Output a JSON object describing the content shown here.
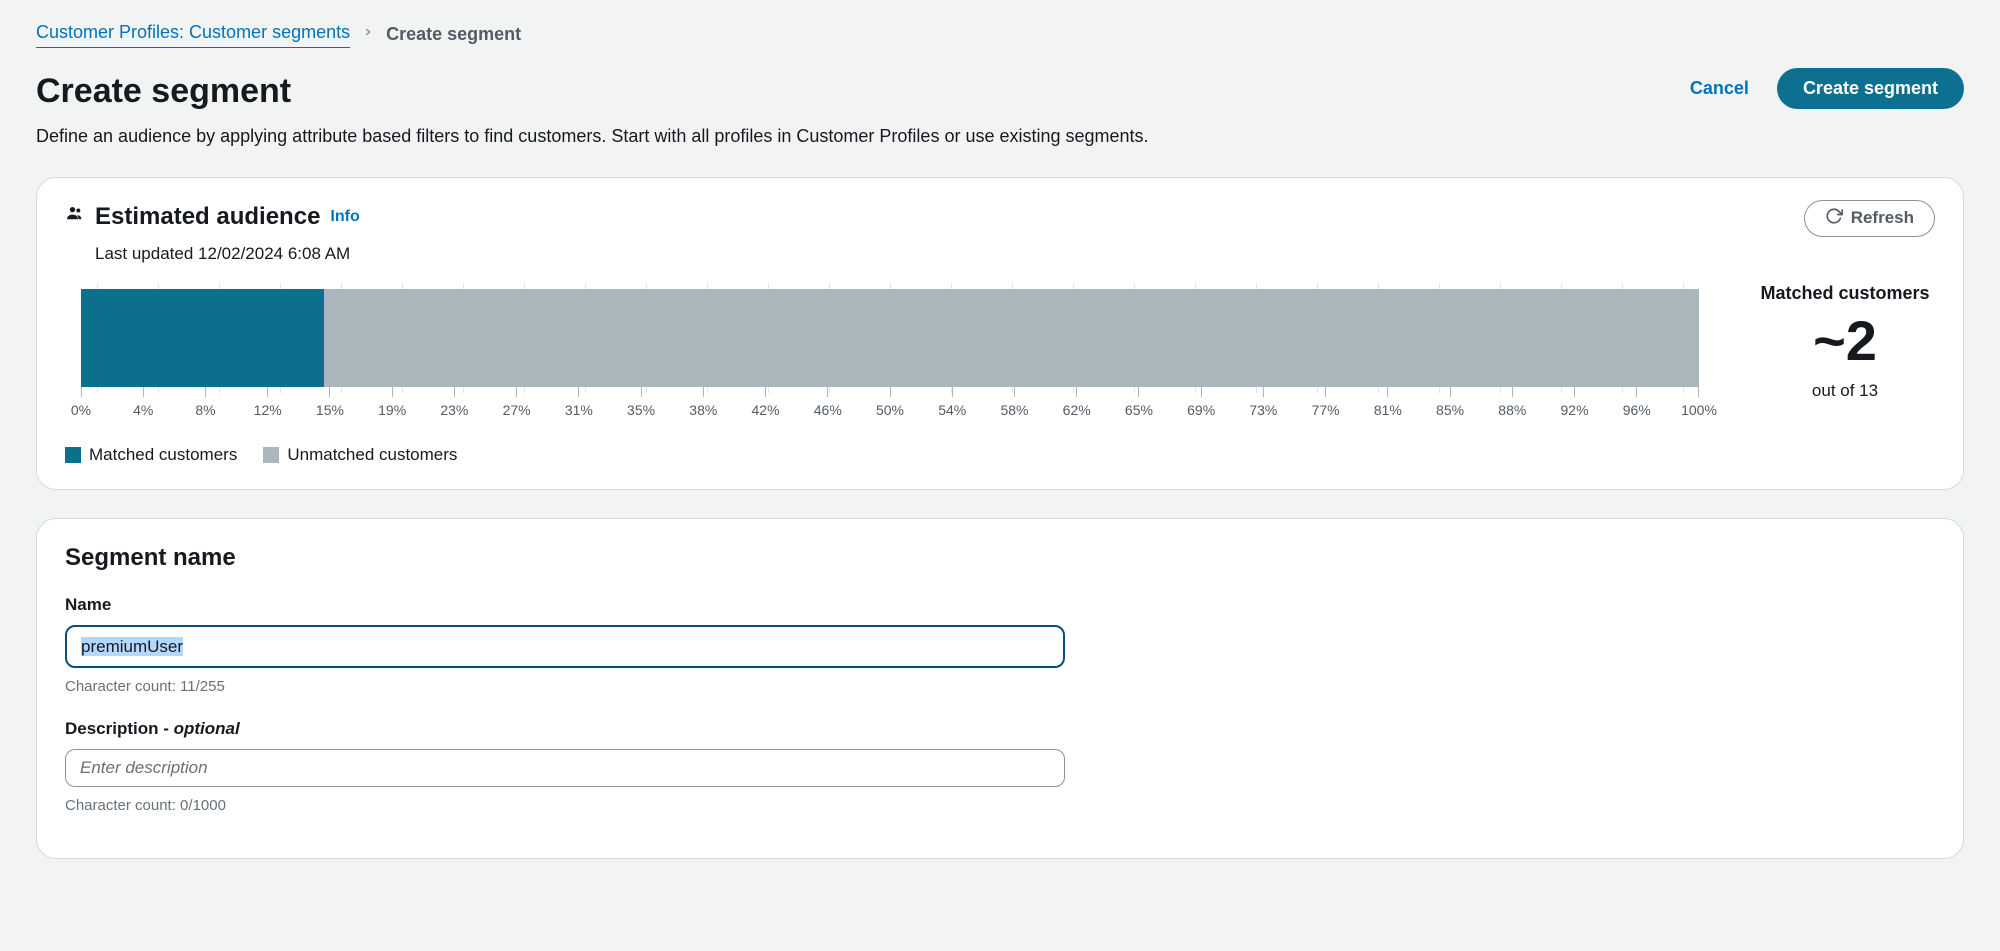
{
  "breadcrumb": {
    "parent": "Customer Profiles: Customer segments",
    "current": "Create segment"
  },
  "header": {
    "title": "Create segment",
    "subtitle": "Define an audience by applying attribute based filters to find customers. Start with all profiles in Customer Profiles or use existing segments.",
    "cancel_label": "Cancel",
    "create_label": "Create segment"
  },
  "audience_panel": {
    "title": "Estimated audience",
    "info_label": "Info",
    "refresh_label": "Refresh",
    "last_updated": "Last updated 12/02/2024 6:08 AM",
    "matched_label": "Matched customers",
    "matched_display": "~2",
    "out_of": "out of 13",
    "legend_matched": "Matched customers",
    "legend_unmatched": "Unmatched customers"
  },
  "chart_data": {
    "type": "bar",
    "orientation": "single-stacked",
    "series": [
      {
        "name": "Matched customers",
        "value": 2,
        "color": "#0d6f8e"
      },
      {
        "name": "Unmatched customers",
        "value": 11,
        "color": "#aab7bd"
      }
    ],
    "total": 13,
    "matched_percent": 15,
    "x_ticks": [
      "0%",
      "4%",
      "8%",
      "12%",
      "15%",
      "19%",
      "23%",
      "27%",
      "31%",
      "35%",
      "38%",
      "42%",
      "46%",
      "50%",
      "54%",
      "58%",
      "62%",
      "65%",
      "69%",
      "73%",
      "77%",
      "81%",
      "85%",
      "88%",
      "92%",
      "96%",
      "100%"
    ],
    "xlabel": "",
    "ylabel": "",
    "xlim": [
      0,
      100
    ]
  },
  "segment_name_panel": {
    "title": "Segment name",
    "name_label": "Name",
    "name_value": "premiumUser",
    "name_count": "Character count: 11/255",
    "desc_label_main": "Description - ",
    "desc_label_optional": "optional",
    "desc_value": "",
    "desc_placeholder": "Enter description",
    "desc_count": "Character count: 0/1000"
  }
}
